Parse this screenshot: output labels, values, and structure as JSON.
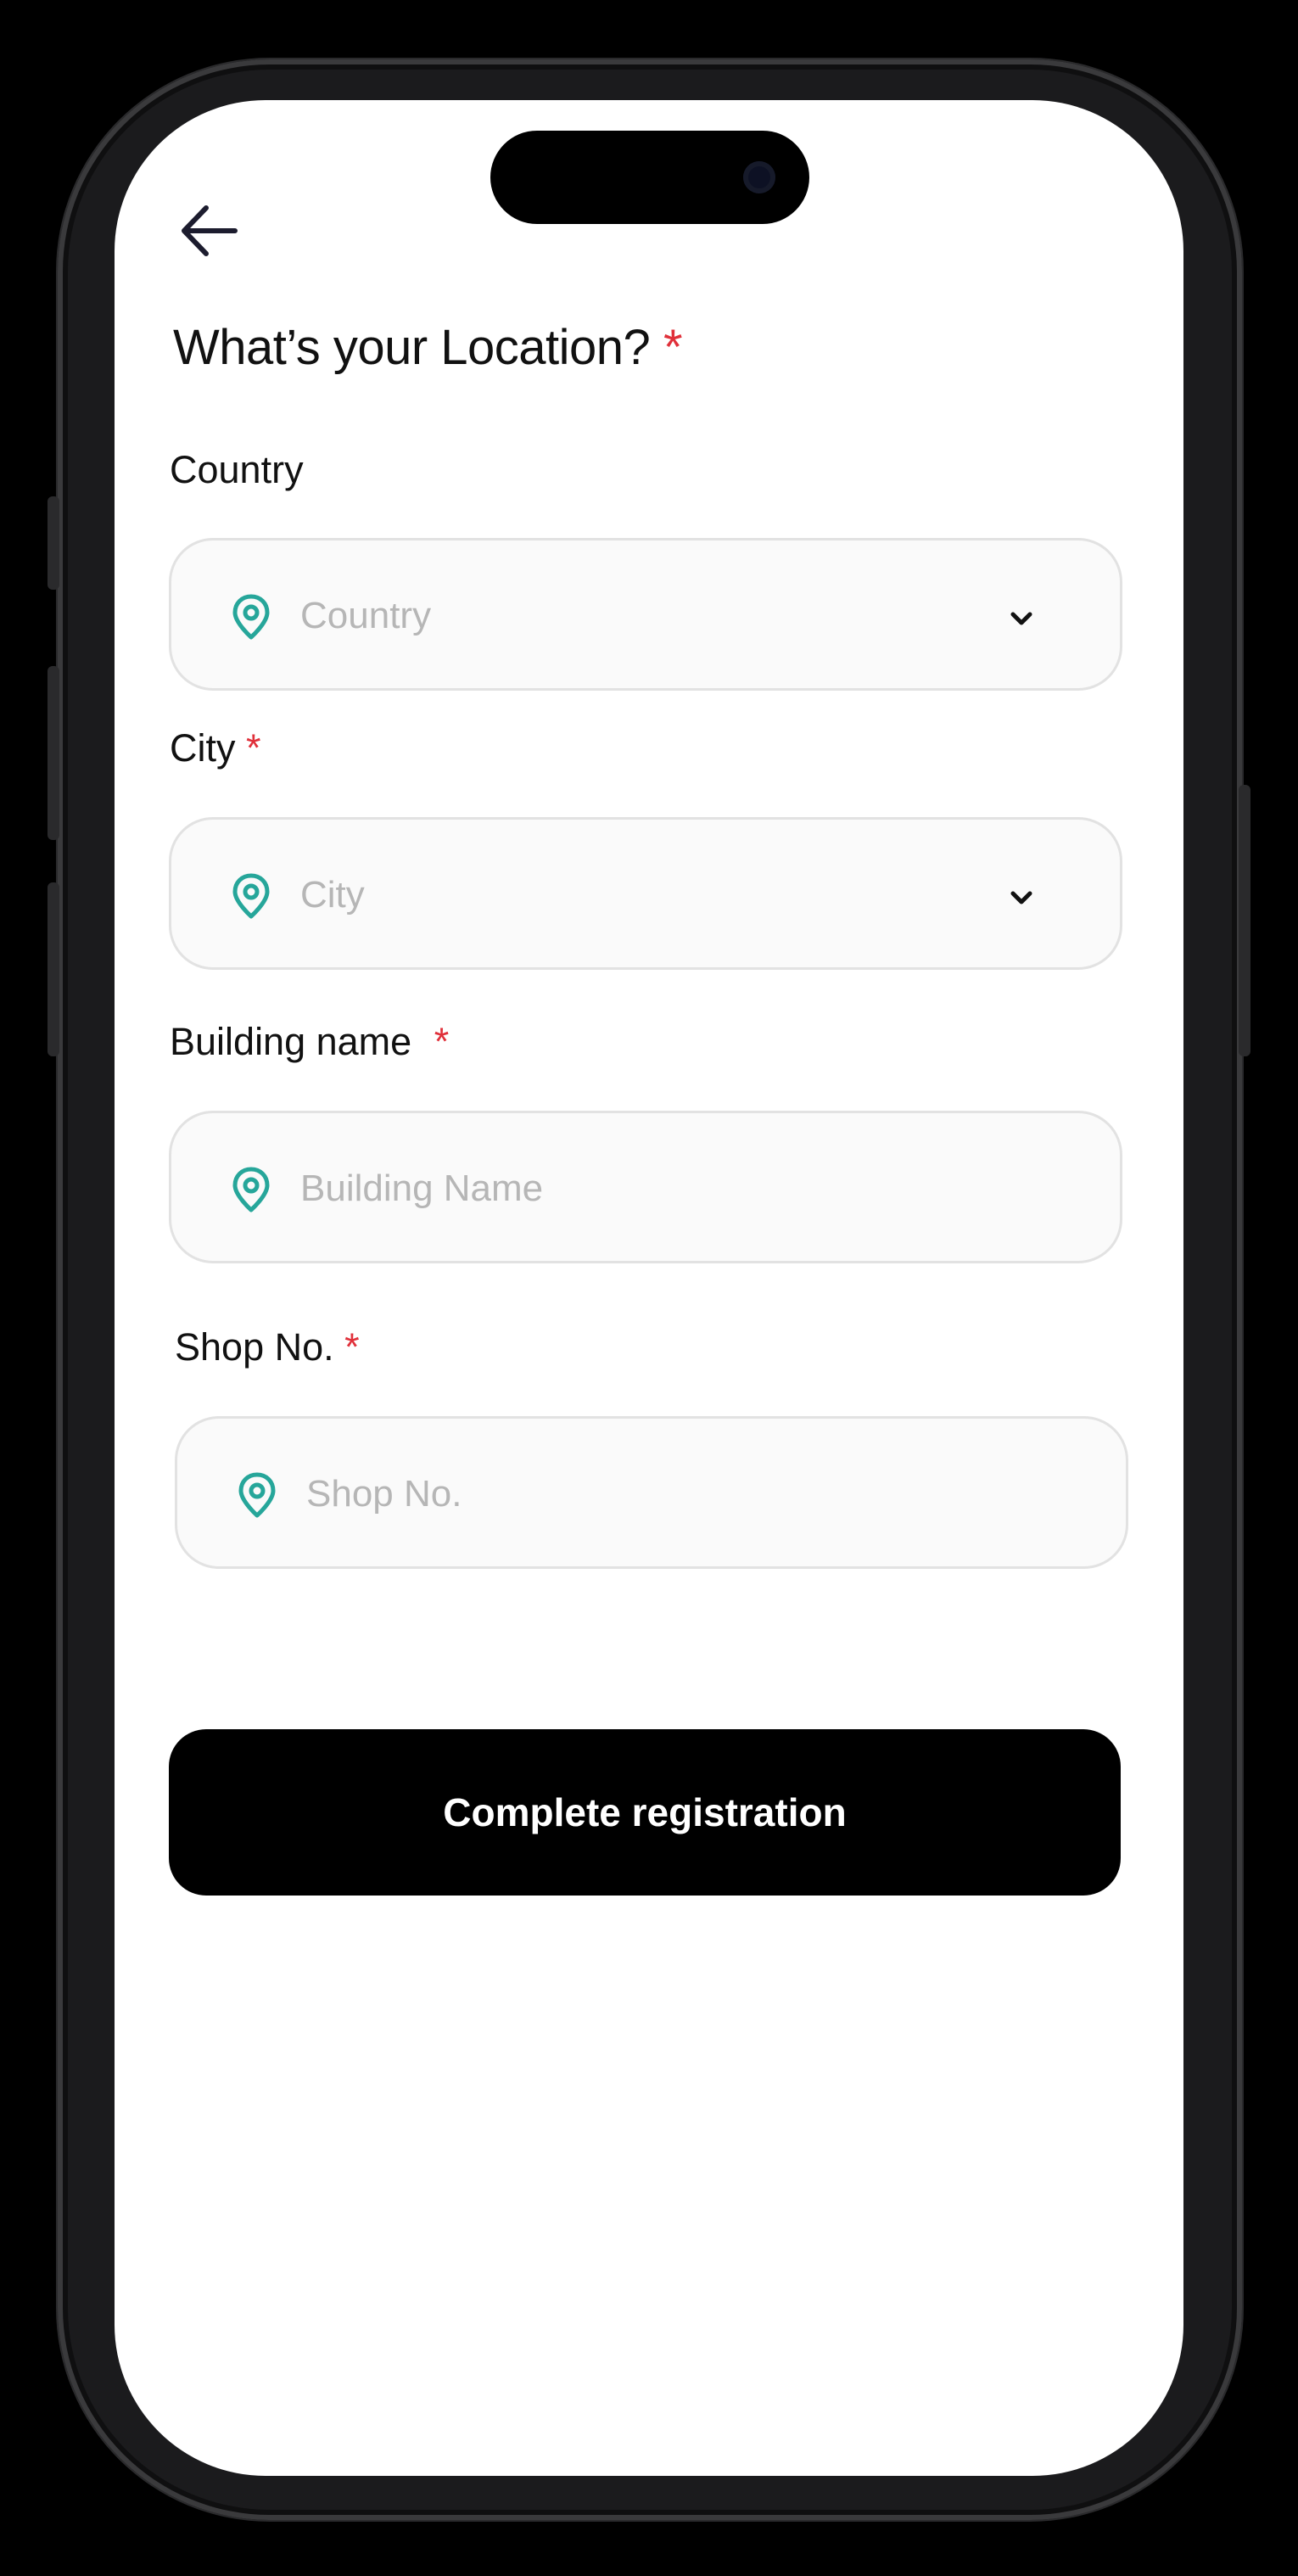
{
  "header": {
    "title": "What’s your Location?",
    "required_mark": "*"
  },
  "form": {
    "fields": [
      {
        "label": "Country",
        "required": false,
        "placeholder": "Country",
        "type": "select"
      },
      {
        "label": "City",
        "required": true,
        "placeholder": "City",
        "type": "select"
      },
      {
        "label": "Building name",
        "required": true,
        "placeholder": "Building Name",
        "type": "text"
      },
      {
        "label": "Shop No.",
        "required": true,
        "placeholder": "Shop No.",
        "type": "text"
      }
    ],
    "submit_label": "Complete registration"
  },
  "icons": {
    "back": "arrow-left-icon",
    "field": "location-pin-icon",
    "dropdown": "chevron-down-icon"
  },
  "colors": {
    "accent": "#26a69a",
    "required": "#e0303a",
    "button_bg": "#000000",
    "field_bg": "#fafafa",
    "field_border": "#e2e2e2",
    "placeholder": "#b6b6b6"
  }
}
